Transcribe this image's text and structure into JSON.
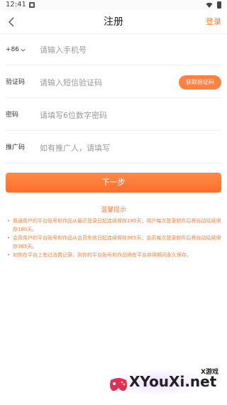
{
  "status_bar": {
    "time": "12:41"
  },
  "nav": {
    "title": "注册",
    "login_label": "登录"
  },
  "phone_row": {
    "country_code": "+86",
    "placeholder": "请输入手机号"
  },
  "code_row": {
    "label": "验证码",
    "placeholder": "请输入短信验证码",
    "button_label": "获取验证码"
  },
  "password_row": {
    "label": "密码",
    "placeholder": "请填写6位数字密码"
  },
  "referrer_row": {
    "label": "推广码",
    "placeholder": "如有推广人，请填写"
  },
  "submit_label": "下一步",
  "tips": {
    "title": "温馨提示",
    "items": [
      "普通用户的平台账号和作品从最近登录日起连续保存180天；用户每次登录软件后将自动延续保存180天。",
      "会员用户的平台账号和作品从会员失效日起连续保存365天；会员每次登录软件后将自动延续保存365天。",
      "如你在平台上有过消费记录，则你的平台账号和作品将在平台存续期间永久保存。"
    ]
  },
  "watermark": {
    "brand": "XYouXi.net",
    "cn": "X游戏"
  },
  "colors": {
    "accent": "#ff7e35",
    "button": "#ff8040"
  }
}
